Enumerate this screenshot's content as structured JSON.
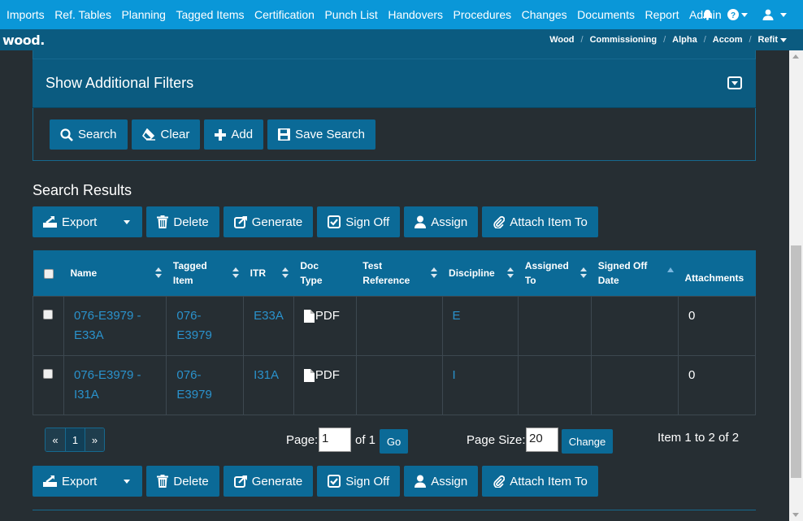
{
  "topnav": {
    "items": [
      "Imports",
      "Ref. Tables",
      "Planning",
      "Tagged Items",
      "Certification",
      "Punch List",
      "Handovers",
      "Procedures",
      "Changes",
      "Documents",
      "Report",
      "Admin"
    ],
    "icons": [
      "bell-icon",
      "help-icon",
      "user-icon"
    ]
  },
  "brand": {
    "logo": "wood."
  },
  "breadcrumb": [
    "Wood",
    "Commissioning",
    "Alpha",
    "Accom",
    "Refit"
  ],
  "filters": {
    "header": "Show Additional Filters",
    "buttons": {
      "search": "Search",
      "clear": "Clear",
      "add": "Add",
      "save": "Save Search"
    }
  },
  "results": {
    "title": "Search Results",
    "actions": {
      "export": "Export",
      "delete": "Delete",
      "generate": "Generate",
      "signoff": "Sign Off",
      "assign": "Assign",
      "attach": "Attach Item To"
    }
  },
  "table": {
    "headers": {
      "name": "Name",
      "tagged_item": "Tagged Item",
      "itr": "ITR",
      "doc_type": "Doc Type",
      "test_reference": "Test Reference",
      "discipline": "Discipline",
      "assigned_to": "Assigned To",
      "signed_off_date": "Signed Off Date",
      "attachments": "Attachments"
    },
    "rows": [
      {
        "name": "076-E3979 - E33A",
        "tagged_item": "076-E3979",
        "itr": "E33A",
        "doc_type": "PDF",
        "test_reference": "",
        "discipline": "E",
        "assigned_to": "",
        "signed_off_date": "",
        "attachments": "0"
      },
      {
        "name": "076-E3979 - I31A",
        "tagged_item": "076-E3979",
        "itr": "I31A",
        "doc_type": "PDF",
        "test_reference": "",
        "discipline": "I",
        "assigned_to": "",
        "signed_off_date": "",
        "attachments": "0"
      }
    ]
  },
  "pagination": {
    "prev": "«",
    "current": "1",
    "next": "»",
    "page_label": "Page:",
    "page_value": "1",
    "of_label": "of 1",
    "go": "Go",
    "size_label": "Page Size:",
    "size_value": "20",
    "change": "Change",
    "summary": "Item 1 to 2 of 2"
  },
  "colors": {
    "nav": "#0a97d8",
    "subbar": "#0b5b80",
    "button": "#0b6a97",
    "background": "#262e33",
    "link": "#2a92cc"
  }
}
